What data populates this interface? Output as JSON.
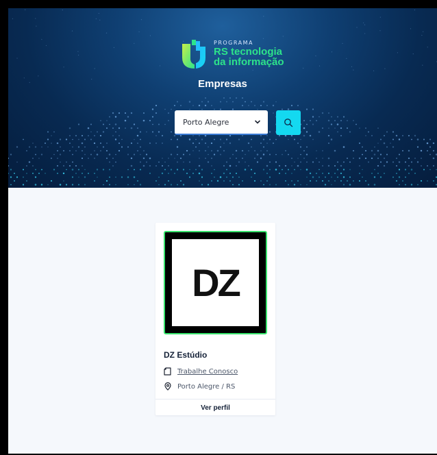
{
  "header": {
    "logo_program": "PROGRAMA",
    "logo_line1": "RS tecnologia",
    "logo_line2": "da informação",
    "title": "Empresas"
  },
  "filter": {
    "city_selected": "Porto Alegre",
    "search_icon": "search-icon"
  },
  "companies": [
    {
      "logo_text": "DZ",
      "name": "DZ Estúdio",
      "jobs_link": "Trabalhe Conosco",
      "location": "Porto Alegre / RS",
      "profile_action": "Ver perfil"
    }
  ],
  "colors": {
    "hero_dark": "#051d3d",
    "hero_light": "#1f5f9c",
    "accent_cyan": "#14d9f0",
    "logo_green": "#2de38a",
    "card_border_green": "#37e36b"
  }
}
